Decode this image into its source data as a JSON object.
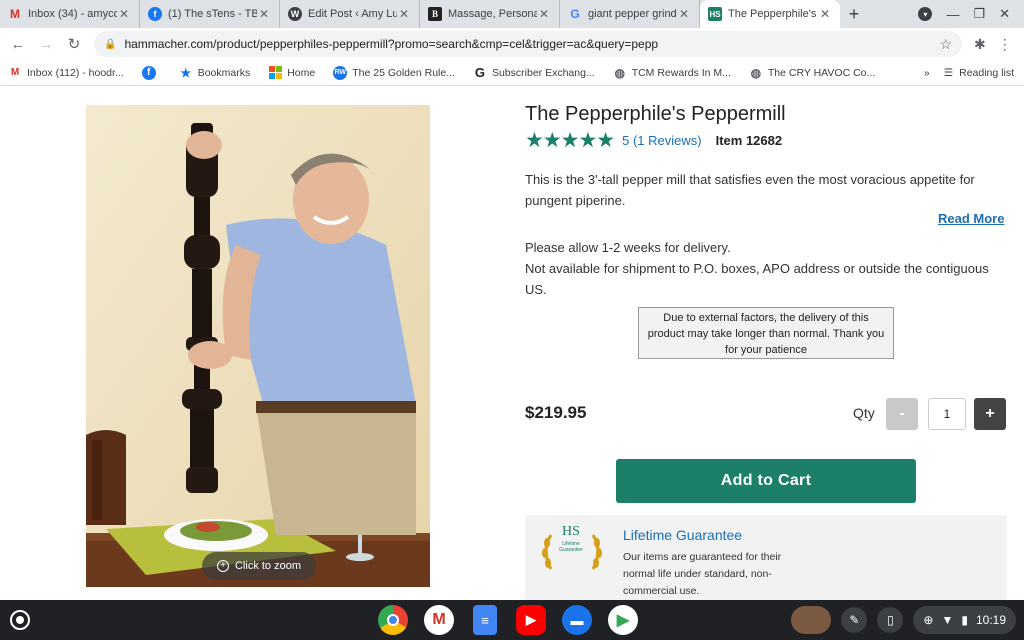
{
  "tabs": [
    {
      "title": "Inbox (34) - amyco",
      "icon": "gmail-icon",
      "active": false
    },
    {
      "title": "(1) The sTens - TB",
      "icon": "facebook-icon",
      "active": false
    },
    {
      "title": "Edit Post ‹ Amy Lu",
      "icon": "wordpress-icon",
      "active": false
    },
    {
      "title": "Massage, Persona",
      "icon": "b-icon",
      "active": false
    },
    {
      "title": "giant pepper grind",
      "icon": "google-icon",
      "active": false
    },
    {
      "title": "The Pepperphile's",
      "icon": "hs-icon",
      "active": true
    }
  ],
  "browser": {
    "url": "hammacher.com/product/pepperphiles-peppermill?promo=search&cmp=cel&trigger=ac&query=pepp"
  },
  "bookmarks": [
    {
      "label": "Inbox (112) - hoodr...",
      "icon": "gmail-icon"
    },
    {
      "label": "",
      "icon": "facebook-icon"
    },
    {
      "label": "Bookmarks",
      "icon": "star-icon"
    },
    {
      "label": "Home",
      "icon": "microsoft-icon"
    },
    {
      "label": "The 25 Golden Rule...",
      "icon": "rw-icon"
    },
    {
      "label": "Subscriber Exchang...",
      "icon": "g-icon"
    },
    {
      "label": "TCM Rewards In M...",
      "icon": "globe-icon"
    },
    {
      "label": "The CRY HAVOC Co...",
      "icon": "globe-icon"
    }
  ],
  "bookmarks_more": "»",
  "reading_list": "Reading list",
  "product": {
    "title": "The Pepperphile's Peppermill",
    "stars": "★★★★★",
    "rating": 5,
    "reviews_link": "5 (1 Reviews)",
    "item_number": "Item 12682",
    "description": "This is the 3'-tall pepper mill that satisfies even the most voracious appetite for pungent piperine.",
    "read_more": "Read More",
    "delivery_line1": "Please allow 1-2 weeks for delivery.",
    "delivery_line2": "Not available for shipment to P.O. boxes, APO address or outside the contiguous US.",
    "notice": "Due to external factors, the delivery of this product may take longer than normal. Thank you for your patience",
    "price": "$219.95",
    "qty_label": "Qty",
    "qty_minus": "-",
    "qty_value": "1",
    "qty_plus": "+",
    "add_to_cart": "Add to Cart",
    "zoom_label": "Click to zoom"
  },
  "guarantee": {
    "badge_hs": "HS",
    "badge_text": "Lifetime Guarantee",
    "title": "Lifetime Guarantee",
    "text": "Our items are guaranteed for their normal life under standard, non-commercial use."
  },
  "shelf": {
    "time": "10:19"
  },
  "colors": {
    "brand_green": "#1b7f6a",
    "link_blue": "#1c6fb5"
  }
}
